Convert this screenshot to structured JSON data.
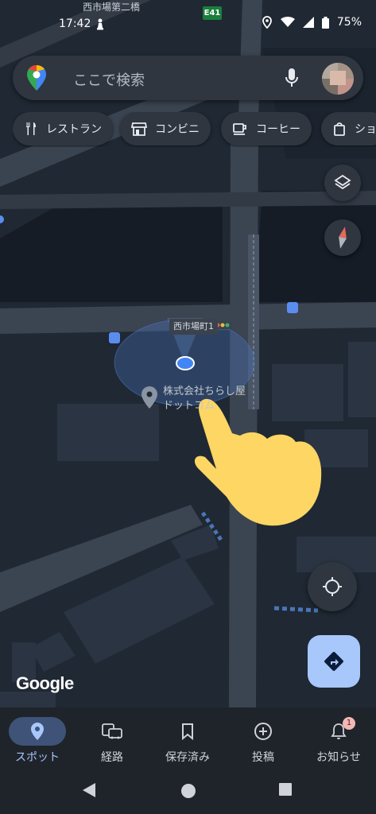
{
  "status": {
    "time": "17:42",
    "battery": "75%"
  },
  "map": {
    "road_name": "西市場第二橋",
    "route_shield": "E41",
    "station_label": "西市場町1",
    "place_name": "株式会社ちらし屋ドットコム"
  },
  "search": {
    "placeholder": "ここで検索"
  },
  "chips": [
    {
      "label": "レストラン",
      "icon": "restaurant-icon"
    },
    {
      "label": "コンビニ",
      "icon": "store-icon"
    },
    {
      "label": "コーヒー",
      "icon": "coffee-icon"
    },
    {
      "label": "ショ",
      "icon": "shopping-icon"
    }
  ],
  "google_logo": "Google",
  "nav": [
    {
      "label": "スポット",
      "icon": "place-icon",
      "active": true
    },
    {
      "label": "経路",
      "icon": "commute-icon",
      "active": false
    },
    {
      "label": "保存済み",
      "icon": "bookmark-icon",
      "active": false
    },
    {
      "label": "投稿",
      "icon": "add-circle-icon",
      "active": false
    },
    {
      "label": "お知らせ",
      "icon": "bell-icon",
      "active": false,
      "badge": "1"
    }
  ],
  "colors": {
    "map_background": "#1f2833",
    "road": "#3a4350",
    "accent": "#a8c7fa",
    "location_dot": "#4285f4"
  }
}
